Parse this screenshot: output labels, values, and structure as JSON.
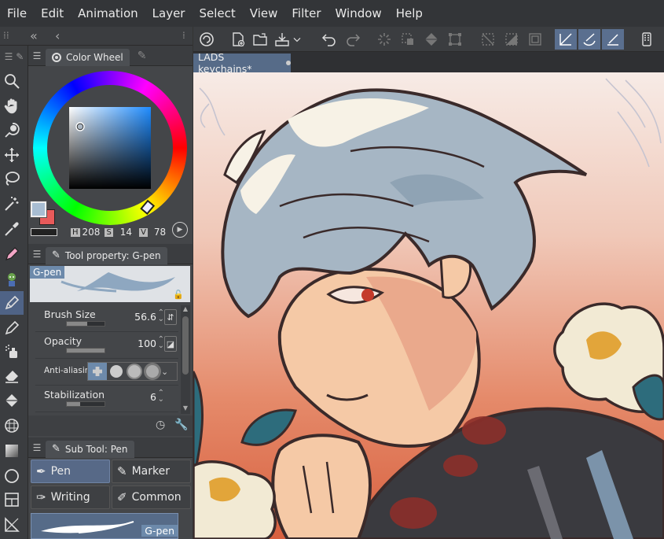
{
  "menu": [
    "File",
    "Edit",
    "Animation",
    "Layer",
    "Select",
    "View",
    "Filter",
    "Window",
    "Help"
  ],
  "panel_nav": {
    "collapse_icon": "double-chevron-left-icon",
    "back_icon": "chevron-left-icon"
  },
  "color_wheel": {
    "tab_label": "Color Wheel",
    "h_label": "H",
    "h_value": "208",
    "s_label": "S",
    "s_value": "14",
    "v_label": "V",
    "v_value": "78",
    "main_color": "#a8bdd2",
    "sub_color": "#e85a5a"
  },
  "tool_property": {
    "tab_label": "Tool property: G-pen",
    "brush_name": "G-pen",
    "rows": [
      {
        "label": "Brush Size",
        "value": "56.6",
        "fill": 0.55
      },
      {
        "label": "Opacity",
        "value": "100",
        "fill": 1.0
      },
      {
        "label": "Anti-aliasing",
        "value": ""
      },
      {
        "label": "Stabilization",
        "value": "6",
        "fill": 0.35
      }
    ]
  },
  "sub_tool": {
    "tab_label": "Sub Tool: Pen",
    "items": [
      "Pen",
      "Marker",
      "Writing",
      "Common"
    ],
    "active": "Pen",
    "preview_label": "G-pen"
  },
  "document": {
    "tab_label": "LADS keychains*"
  },
  "colors": {
    "accent": "#566b88",
    "active_tool": "#4f6386",
    "panel_bg": "#444649"
  }
}
